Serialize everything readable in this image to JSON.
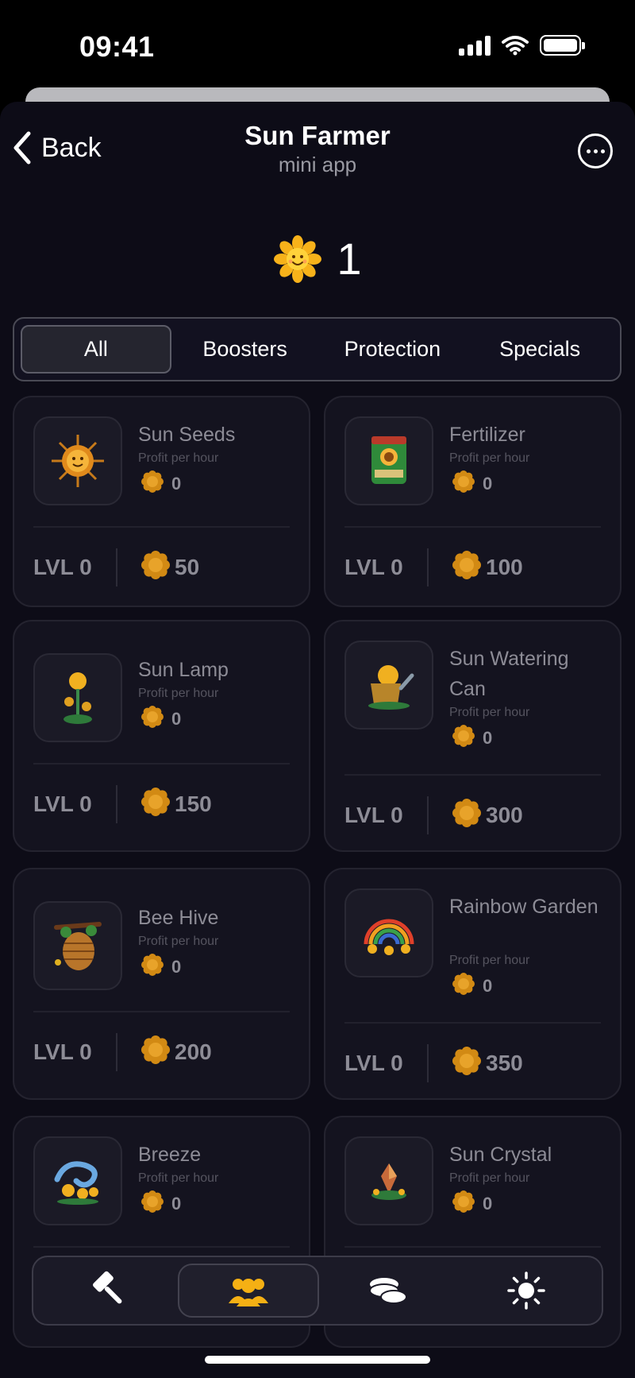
{
  "status_bar": {
    "time": "09:41"
  },
  "nav": {
    "back_label": "Back",
    "title": "Sun Farmer",
    "subtitle": "mini app"
  },
  "balance": {
    "value": "1",
    "icon": "sunflower-icon"
  },
  "tabs": [
    {
      "label": "All",
      "active": true
    },
    {
      "label": "Boosters",
      "active": false
    },
    {
      "label": "Protection",
      "active": false
    },
    {
      "label": "Specials",
      "active": false
    }
  ],
  "profit_label": "Profit per hour",
  "cards": [
    {
      "name": "Sun Seeds",
      "icon": "sun-seeds-icon",
      "profit": "0",
      "level": "LVL 0",
      "price": "50"
    },
    {
      "name": "Fertilizer",
      "icon": "fertilizer-bag-icon",
      "profit": "0",
      "level": "LVL 0",
      "price": "100"
    },
    {
      "name": "Sun Lamp",
      "icon": "sun-lamp-icon",
      "profit": "0",
      "level": "LVL 0",
      "price": "150"
    },
    {
      "name": "Sun Watering Can",
      "icon": "watering-can-icon",
      "profit": "0",
      "level": "LVL 0",
      "price": "300"
    },
    {
      "name": "Bee Hive",
      "icon": "bee-hive-icon",
      "profit": "0",
      "level": "LVL 0",
      "price": "200"
    },
    {
      "name": "Rainbow Garden",
      "icon": "rainbow-garden-icon",
      "profit": "0",
      "level": "LVL 0",
      "price": "350"
    },
    {
      "name": "Breeze",
      "icon": "breeze-icon",
      "profit": "0"
    },
    {
      "name": "Sun Crystal",
      "icon": "sun-crystal-icon",
      "profit": "0"
    }
  ],
  "bottom_nav": [
    {
      "icon": "hammer-icon",
      "active": false
    },
    {
      "icon": "friends-icon",
      "active": true
    },
    {
      "icon": "coins-icon",
      "active": false
    },
    {
      "icon": "sun-icon",
      "active": false
    }
  ],
  "colors": {
    "background": "#0d0c17",
    "card": "#14131f",
    "accent": "#f5b014",
    "muted_text": "#8d8c96"
  }
}
